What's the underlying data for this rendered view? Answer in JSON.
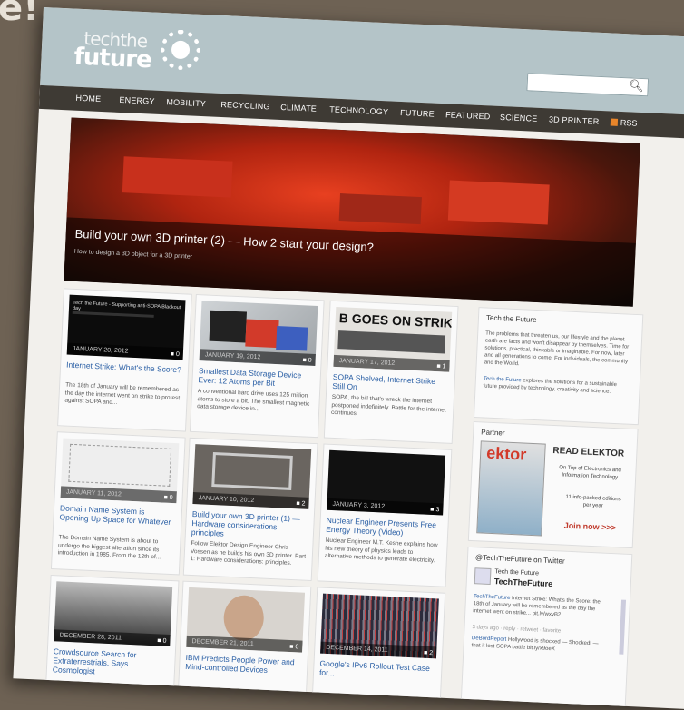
{
  "page": {
    "bg_text": "e!"
  },
  "header": {
    "logo_top": "techthe",
    "logo_bottom": "future"
  },
  "nav": {
    "items": [
      "HOME",
      "ENERGY",
      "MOBILITY",
      "RECYCLING",
      "CLIMATE",
      "TECHNOLOGY",
      "FUTURE",
      "FEATURED",
      "SCIENCE",
      "3D PRINTER"
    ],
    "rss": "RSS"
  },
  "hero": {
    "title": "Build your own 3D printer (2) — How 2 start your design?",
    "subtitle": "How to design a 3D object for a 3D printer"
  },
  "articles": [
    {
      "date": "JANUARY 20, 2012",
      "comments": "0",
      "title": "Internet Strike: What's the Score?",
      "body": "The 18th of January will be remembered as the day the internet went on strike to protest against SOPA and...",
      "thumb_caption": "Tech the Future - Supporting anti-SOPA Blackout day"
    },
    {
      "date": "JANUARY 19, 2012",
      "comments": "0",
      "title": "Smallest Data Storage Device Ever: 12 Atoms per Bit",
      "body": "A conventional hard drive uses 125 million atoms to store a bit. The smallest magnetic data storage device in..."
    },
    {
      "date": "JANUARY 17, 2012",
      "comments": "1",
      "title": "SOPA Shelved, Internet Strike Still On",
      "body": "SOPA, the bill that's wreck the internet postponed indefinitely. Battle for the internet continues.",
      "thumb_caption": "B GOES ON STRIK"
    },
    {
      "date": "JANUARY 11, 2012",
      "comments": "0",
      "title": "Domain Name System is Opening Up Space for Whatever",
      "body": "The Domain Name System is about to undergo the biggest alteration since its introduction in 1985. From the 12th of..."
    },
    {
      "date": "JANUARY 10, 2012",
      "comments": "2",
      "title": "Build your own 3D printer (1) — Hardware considerations: principles",
      "body": "Follow Elektor Design Engineer Chris Vossen as he builds his own 3D printer. Part 1: Hardware considerations: principles."
    },
    {
      "date": "JANUARY 3, 2012",
      "comments": "3",
      "title": "Nuclear Engineer Presents Free Energy Theory (Video)",
      "body": "Nuclear Engineer M.T. Keshe explains how his new theory of physics leads to alternative methods to generate electricity."
    },
    {
      "date": "DECEMBER 28, 2011",
      "comments": "0",
      "title": "Crowdsource Search for Extraterrestrials, Says Cosmologist",
      "body": ""
    },
    {
      "date": "DECEMBER 21, 2011",
      "comments": "0",
      "title": "IBM Predicts People Power and Mind-controlled Devices",
      "body": ""
    },
    {
      "date": "DECEMBER 14, 2011",
      "comments": "2",
      "title": "Google's IPv6 Rollout Test Case for...",
      "body": ""
    }
  ],
  "sidebar": {
    "about": {
      "heading": "Tech the Future",
      "text1": "The problems that threaten us, our lifestyle and the planet earth are facts and won't disappear by themselves. Time for solutions, practical, thinkable or imaginable. For now, later and all generations to come. For individuals, the community and the World.",
      "link": "Tech the Future",
      "text2": " explores the solutions for a sustainable future provided by technology, creativity and science."
    },
    "partner": {
      "heading": "Partner",
      "brand": "ektor",
      "read": "READ ELEKTOR",
      "tagline": "On Top of Electronics and Information Technology",
      "editions": "11 info-packed editions per year",
      "cta": "Join now >>>"
    },
    "twitter": {
      "heading": "@TechTheFuture on Twitter",
      "name": "Tech the Future",
      "handle": "TechTheFuture",
      "tweet1_user": "TechTheFuture",
      "tweet1": " Internet Strike: What's the Score: the 18th of January will be remembered as the day the internet went on strike... bit.ly/wxyB2",
      "tweet1_meta": "3 days ago · reply · retweet · favorite",
      "tweet2_user": "DeBordReport",
      "tweet2": " Hollywood is shocked — Shocked! — that it lost SOPA battle bit.ly/x9oeX"
    }
  },
  "colors": {
    "header": "#b4c4c8",
    "nav": "#3e3a34",
    "link": "#2a5fa5",
    "cta": "#c0392b"
  }
}
